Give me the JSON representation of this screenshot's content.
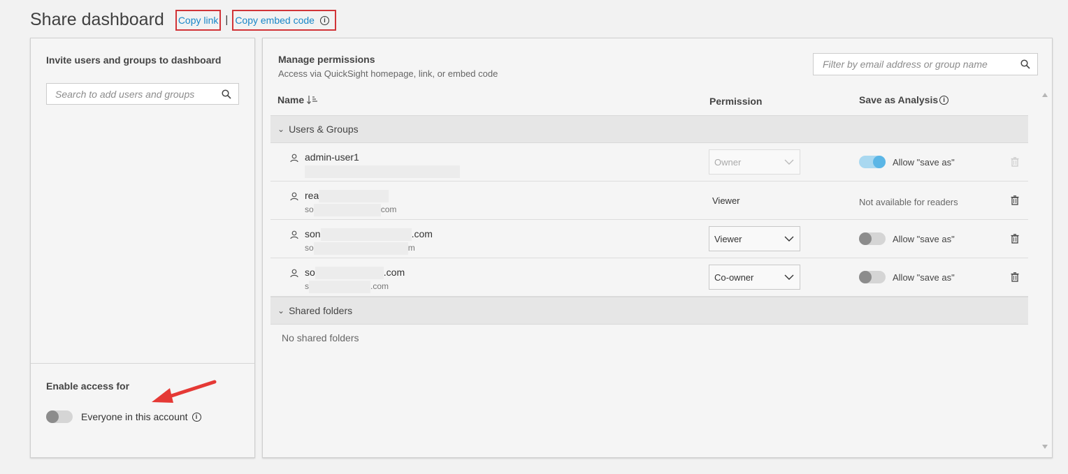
{
  "header": {
    "title": "Share dashboard",
    "copy_link": "Copy link",
    "separator": "|",
    "copy_embed": "Copy embed code"
  },
  "invite": {
    "title": "Invite users and groups to dashboard",
    "search_placeholder": "Search to add users and groups"
  },
  "enable_access": {
    "title": "Enable access for",
    "everyone_label": "Everyone in this account",
    "everyone_enabled": false
  },
  "manage": {
    "title": "Manage permissions",
    "subtitle": "Access via QuickSight homepage, link, or embed code",
    "filter_placeholder": "Filter by email address or group name"
  },
  "table": {
    "col_name": "Name",
    "col_permission": "Permission",
    "col_save": "Save as Analysis",
    "groups": {
      "users_label": "Users & Groups",
      "folders_label": "Shared folders",
      "no_folders": "No shared folders"
    },
    "rows": [
      {
        "name": "admin-user1",
        "email": "",
        "permission": "Owner",
        "save_label": "Allow \"save as\"",
        "save_enabled": true
      },
      {
        "name_prefix": "rea",
        "email_prefix": "so",
        "email_suffix": "com",
        "permission": "Viewer",
        "save_label": "Not available for readers"
      },
      {
        "name_prefix": "son",
        "name_suffix": ".com",
        "email_prefix": "so",
        "email_suffix": "m",
        "permission": "Viewer",
        "save_label": "Allow \"save as\"",
        "save_enabled": false
      },
      {
        "name_prefix": "so",
        "name_suffix": ".com",
        "email_prefix": "s",
        "email_suffix": ".com",
        "permission": "Co-owner",
        "save_label": "Allow \"save as\"",
        "save_enabled": false
      }
    ]
  },
  "colors": {
    "link": "#1a87c8",
    "highlight_box": "#d13438",
    "arrow": "#e53935",
    "toggle_on": "#5bb6e6"
  }
}
